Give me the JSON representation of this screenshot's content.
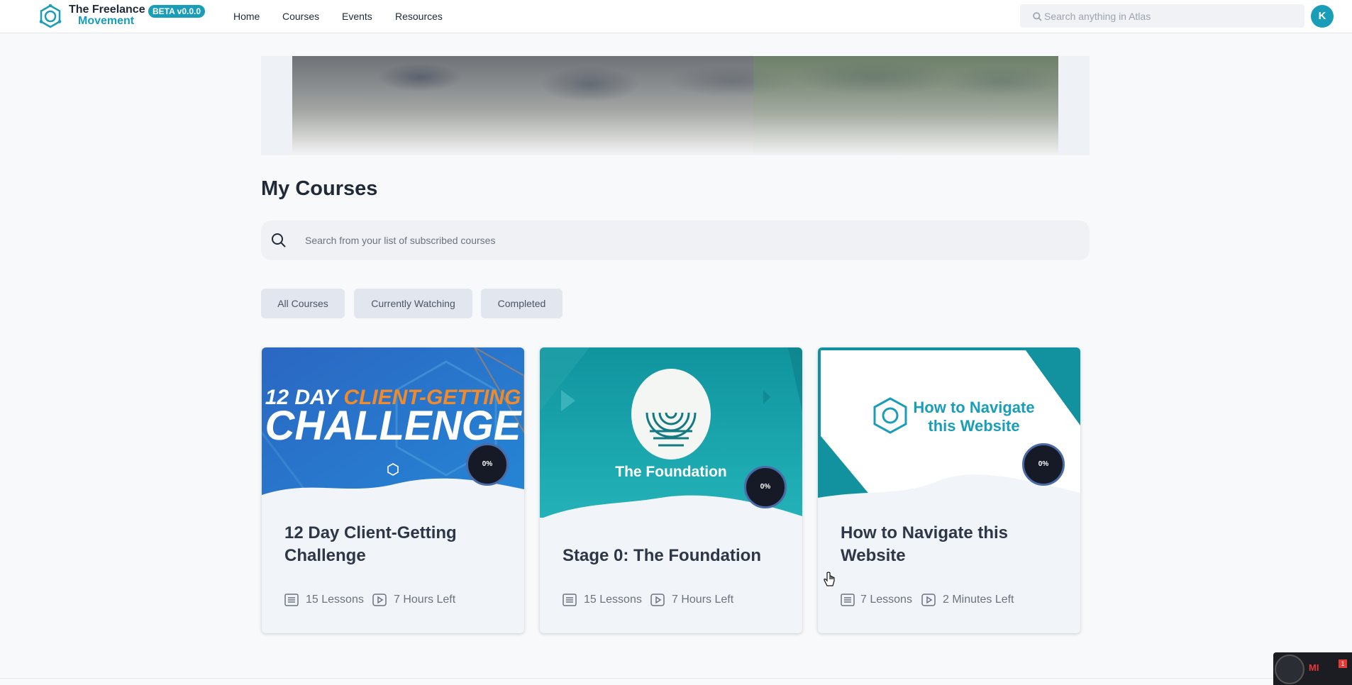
{
  "header": {
    "brand_line1": "The Freelance",
    "brand_line2": "Movement",
    "beta_badge": "BETA v0.0.0",
    "nav": [
      {
        "label": "Home"
      },
      {
        "label": "Courses"
      },
      {
        "label": "Events"
      },
      {
        "label": "Resources"
      }
    ],
    "search_placeholder": "Search anything in Atlas",
    "avatar_initial": "K"
  },
  "main": {
    "title": "My Courses",
    "search_placeholder": "Search from your list of subscribed courses",
    "tabs": [
      {
        "label": "All Courses"
      },
      {
        "label": "Currently Watching"
      },
      {
        "label": "Completed"
      }
    ],
    "courses": [
      {
        "title": "12 Day Client-Getting Challenge",
        "thumb_line1_a": "12 DAY ",
        "thumb_line1_b": "CLIENT-GETTING",
        "thumb_line2": "CHALLENGE",
        "progress": "0%",
        "lessons": "15 Lessons",
        "time_left": "7 Hours Left"
      },
      {
        "title": "Stage 0: The Foundation",
        "thumb_text": "The Foundation",
        "progress": "0%",
        "lessons": "15 Lessons",
        "time_left": "7 Hours Left"
      },
      {
        "title": "How to Navigate this Website",
        "thumb_line1": "How to Navigate",
        "thumb_line2": "this Website",
        "progress": "0%",
        "lessons": "7 Lessons",
        "time_left": "2 Minutes Left"
      }
    ]
  },
  "tray": {
    "label": "MI",
    "badge": "1"
  },
  "colors": {
    "accent": "#1a9db8",
    "progress_ring": "#4a6aa8",
    "card_bg": "#f1f4f8"
  },
  "icons": [
    "logo-icon",
    "search-icon",
    "lessons-icon",
    "play-icon",
    "hand-cursor-icon"
  ]
}
